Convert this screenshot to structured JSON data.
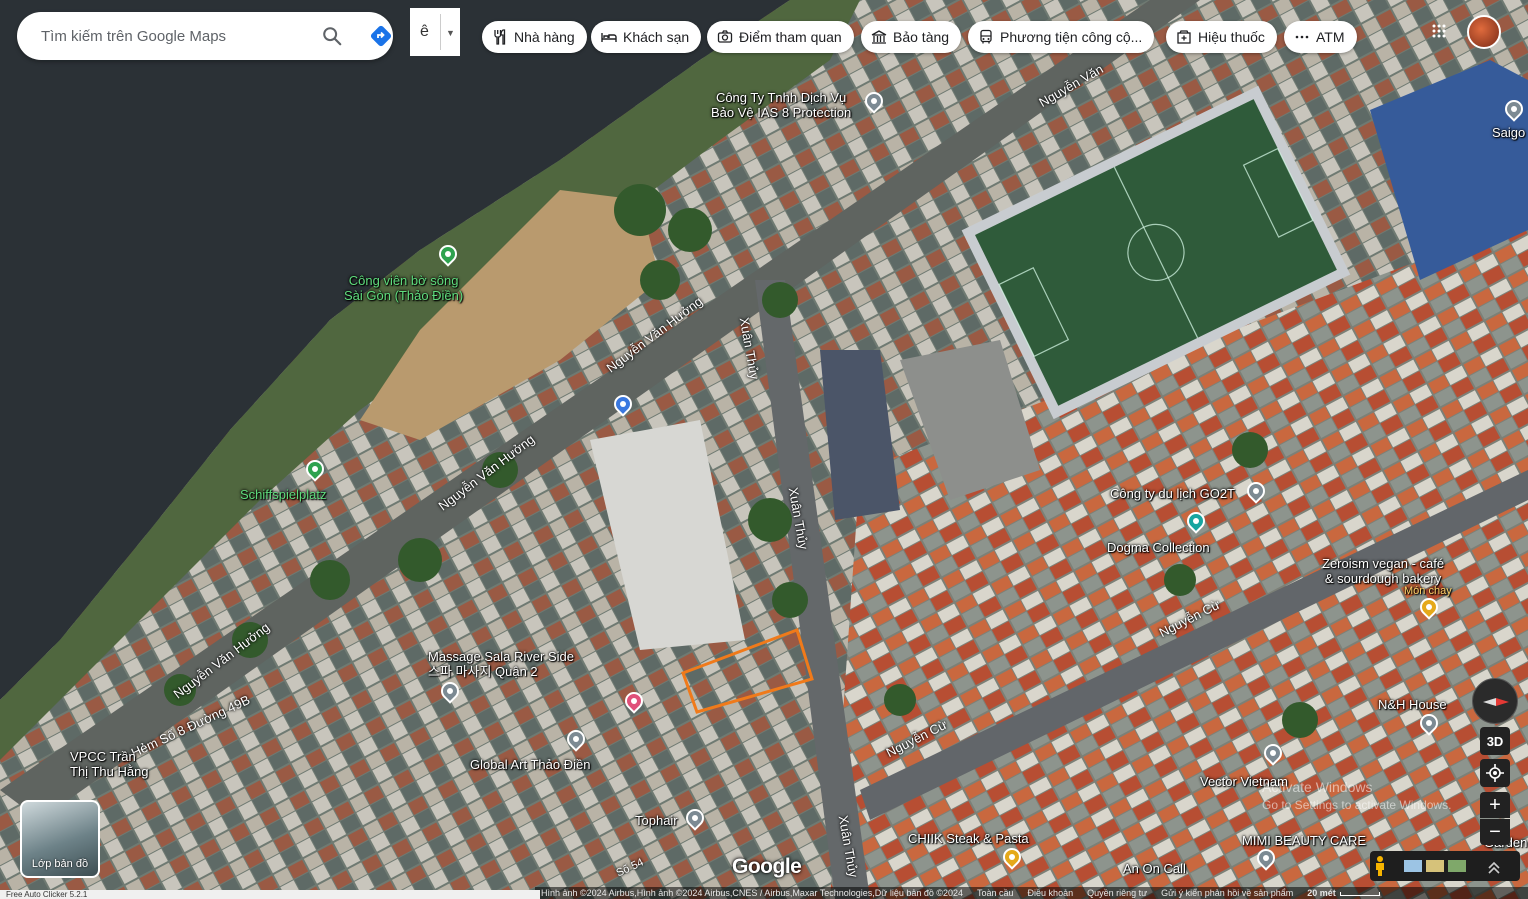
{
  "search": {
    "placeholder": "Tìm kiếm trên Google Maps"
  },
  "language": {
    "char": "ê"
  },
  "chips": [
    {
      "name": "restaurants",
      "label": "Nhà hàng",
      "icon": "fork-knife-icon"
    },
    {
      "name": "hotels",
      "label": "Khách sạn",
      "icon": "bed-icon"
    },
    {
      "name": "attractions",
      "label": "Điểm tham quan",
      "icon": "camera-icon"
    },
    {
      "name": "museums",
      "label": "Bảo tàng",
      "icon": "museum-icon"
    },
    {
      "name": "transit",
      "label": "Phương tiện công cộ...",
      "icon": "bus-icon"
    },
    {
      "name": "pharmacy",
      "label": "Hiệu thuốc",
      "icon": "pharmacy-icon"
    },
    {
      "name": "atm",
      "label": "ATM",
      "icon": "atm-icon"
    }
  ],
  "places": [
    {
      "name": "ias8",
      "label": "Công Ty Tnhh Dịch Vụ\nBảo Vệ IAS 8 Protection",
      "pin": "gray"
    },
    {
      "name": "saigo",
      "label": "Saigo",
      "pin": "gray"
    },
    {
      "name": "park",
      "label": "Công viên bờ sông\nSài Gòn (Thảo Điền)",
      "pin": "green"
    },
    {
      "name": "schiff",
      "label": "Schiffspielplatz",
      "pin": "green"
    },
    {
      "name": "go2t",
      "label": "Công ty du lịch GO2T",
      "pin": "gray"
    },
    {
      "name": "dogma",
      "label": "Dogma Collection",
      "pin": "teal"
    },
    {
      "name": "zeroism",
      "label": "Zeroism vegan - café\n& sourdough bakery",
      "sublabel": "Món chay",
      "pin": "gold"
    },
    {
      "name": "massage",
      "label": "Massage Sala River Side\n스파 마사지 Quận 2",
      "pin": "gray"
    },
    {
      "name": "vpcc",
      "label": "VPCC Trần\nThị Thu Hằng",
      "pin": "gray"
    },
    {
      "name": "globalart",
      "label": "Global Art Thảo Điền",
      "pin": "gray"
    },
    {
      "name": "tophair",
      "label": "Tophair",
      "pin": "gray"
    },
    {
      "name": "chiik",
      "label": "CHIIK Steak & Pasta",
      "pin": "gold"
    },
    {
      "name": "anoncall",
      "label": "An On Call",
      "pin": "gray"
    },
    {
      "name": "mimi",
      "label": "MIMI BEAUTY CARE",
      "pin": "gray"
    },
    {
      "name": "vector",
      "label": "Vector Vietnam",
      "pin": "gray"
    },
    {
      "name": "nhihouse",
      "label": "N&H House",
      "pin": "gray"
    },
    {
      "name": "garden",
      "label": "Garden Kiss",
      "pin": "gray"
    }
  ],
  "roads": {
    "nvh1": "Nguyễn Văn Hưởng",
    "nvh2": "Nguyễn Văn Hưởng",
    "nvh3": "Nguyễn Văn Hưởng",
    "nvh4": "Nguyễn Văn",
    "xt1": "Xuân Thủy",
    "xt2": "Xuân Thủy",
    "xt3": "Xuân Thủy",
    "nc1": "Nguyễn Cừ",
    "nc2": "Nguyễn Cừ",
    "hem": "Hẻm Số 8 Đường 49B",
    "s54": "Số 54"
  },
  "controls": {
    "layers_label": "Lớp bản đồ",
    "btn_3d": "3D",
    "zoom_in": "+",
    "zoom_out": "−"
  },
  "google_logo": "Google",
  "footer": {
    "attribution": "Hình ảnh ©2024 Airbus,Hình ảnh ©2024 Airbus,CNES / Airbus,Maxar Technologies,Dữ liệu bản đồ ©2024",
    "links": [
      "Toàn cầu",
      "Điều khoản",
      "Quyền riêng tư",
      "Gửi ý kiến phản hồi về sản phẩm"
    ],
    "scale": "20 mét"
  },
  "watermark": {
    "line1": "Activate Windows",
    "line2": "Go to Settings to activate Windows."
  },
  "taskbar_text": "Free Auto Clicker 5.2.1",
  "colors": {
    "highlight": "#f07a1a",
    "water": "#2b3136"
  }
}
